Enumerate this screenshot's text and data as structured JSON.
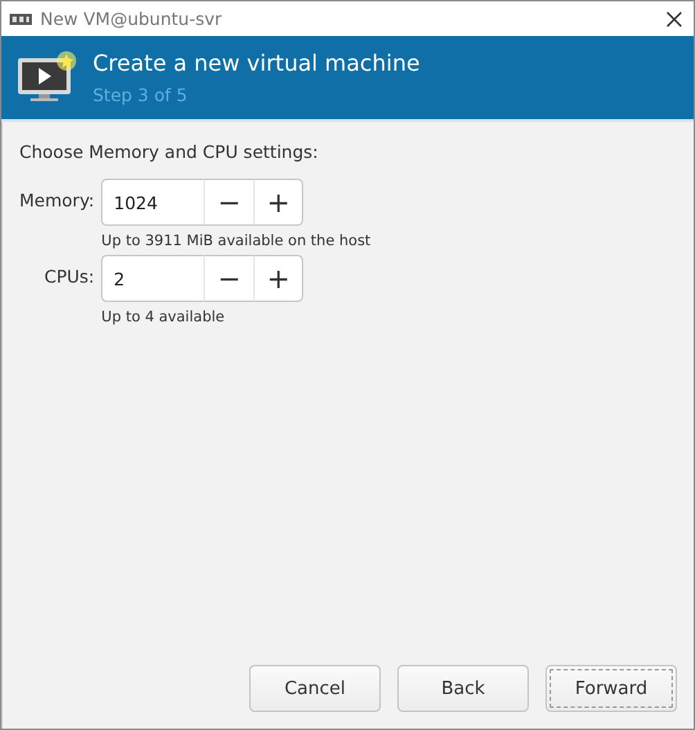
{
  "window": {
    "title": "New VM@ubuntu-svr"
  },
  "header": {
    "title": "Create a new virtual machine",
    "step": "Step 3 of 5"
  },
  "prompt": "Choose Memory and CPU settings:",
  "fields": [
    {
      "label": "Memory:",
      "value": "1024",
      "minus": "−",
      "plus": "+",
      "hint": "Up to 3911 MiB available on the host"
    },
    {
      "label": "CPUs:",
      "value": "2",
      "minus": "−",
      "plus": "+",
      "hint": "Up to 4 available"
    }
  ],
  "buttons": [
    {
      "label": "Cancel",
      "focused": false
    },
    {
      "label": "Back",
      "focused": false
    },
    {
      "label": "Forward",
      "focused": true
    }
  ]
}
